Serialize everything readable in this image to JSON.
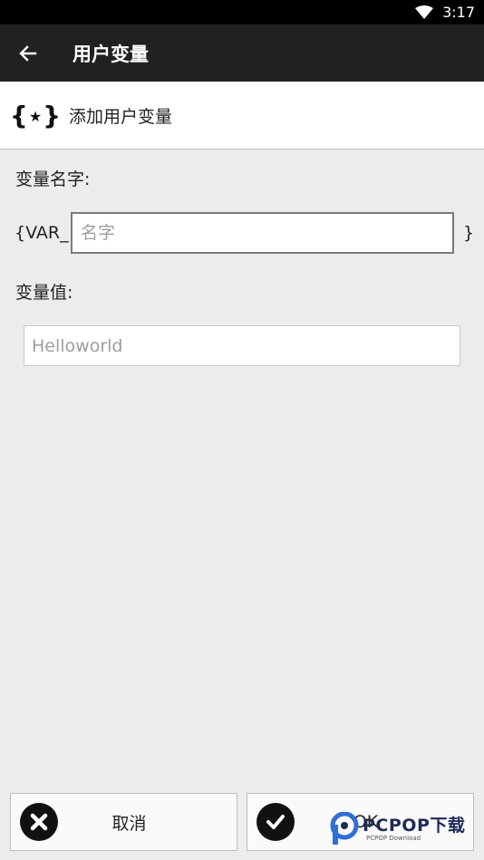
{
  "status_bar": {
    "time": "3:17"
  },
  "app_bar": {
    "title": "用户变量"
  },
  "header": {
    "title": "添加用户变量"
  },
  "form": {
    "name_label": "变量名字:",
    "name_prefix": "{VAR_",
    "name_placeholder": "名字",
    "name_value": "",
    "name_suffix": "}",
    "value_label": "变量值:",
    "value_placeholder": "Helloworld",
    "value_value": ""
  },
  "buttons": {
    "cancel_label": "取消",
    "ok_label": "OK"
  },
  "watermark": {
    "text": "PCPOP下载",
    "subtext": "PCPOP Download"
  },
  "colors": {
    "app_bar": "#212121",
    "status_bar": "#000000",
    "background": "#ececec"
  }
}
